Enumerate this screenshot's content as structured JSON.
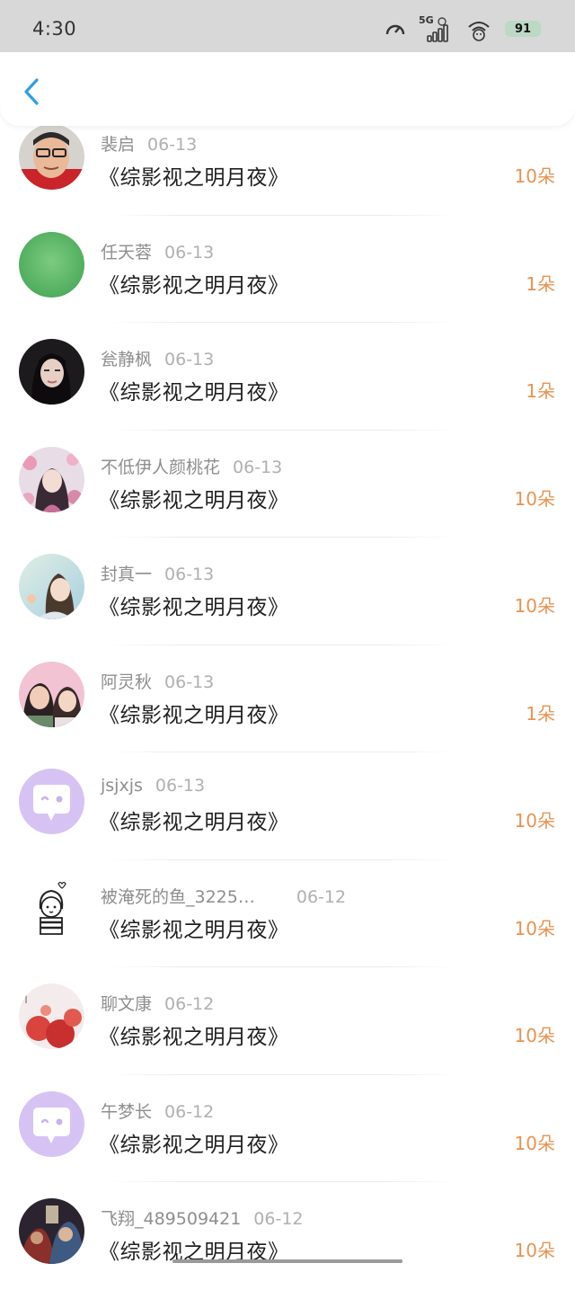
{
  "status_bar": {
    "time": "4:30",
    "network": "5G",
    "battery": "91"
  },
  "colors": {
    "accent_back": "#2f9ee6",
    "amount": "#e89350",
    "avatar_chat_bg": "#d6c3f3"
  },
  "gifts": [
    {
      "user": "裴启",
      "date": "06-13",
      "title": "《综影视之明月夜》",
      "amount": "10朵",
      "avatar": "photo-man-glasses"
    },
    {
      "user": "任天蓉",
      "date": "06-13",
      "title": "《综影视之明月夜》",
      "amount": "1朵",
      "avatar": "green-circle"
    },
    {
      "user": "瓮静枫",
      "date": "06-13",
      "title": "《综影视之明月夜》",
      "amount": "1朵",
      "avatar": "photo-girl-dark"
    },
    {
      "user": "不低伊人颜桃花",
      "date": "06-13",
      "title": "《综影视之明月夜》",
      "amount": "10朵",
      "avatar": "illustration-girl-flowers"
    },
    {
      "user": "封真一",
      "date": "06-13",
      "title": "《综影视之明月夜》",
      "amount": "10朵",
      "avatar": "photo-girl-light"
    },
    {
      "user": "阿灵秋",
      "date": "06-13",
      "title": "《综影视之明月夜》",
      "amount": "1朵",
      "avatar": "photo-couple"
    },
    {
      "user": "jsjxjs",
      "date": "06-13",
      "title": "《综影视之明月夜》",
      "amount": "10朵",
      "avatar": "chat-bubble"
    },
    {
      "user": "被淹死的鱼_3225…",
      "date": "06-12",
      "title": "《综影视之明月夜》",
      "amount": "10朵",
      "avatar": "sketch-girl"
    },
    {
      "user": "聊文康",
      "date": "06-12",
      "title": "《综影视之明月夜》",
      "amount": "10朵",
      "avatar": "red-flowers"
    },
    {
      "user": "午梦长",
      "date": "06-12",
      "title": "《综影视之明月夜》",
      "amount": "10朵",
      "avatar": "chat-bubble"
    },
    {
      "user": "飞翔_489509421",
      "date": "06-12",
      "title": "《综影视之明月夜》",
      "amount": "10朵",
      "avatar": "poster-dark"
    }
  ]
}
